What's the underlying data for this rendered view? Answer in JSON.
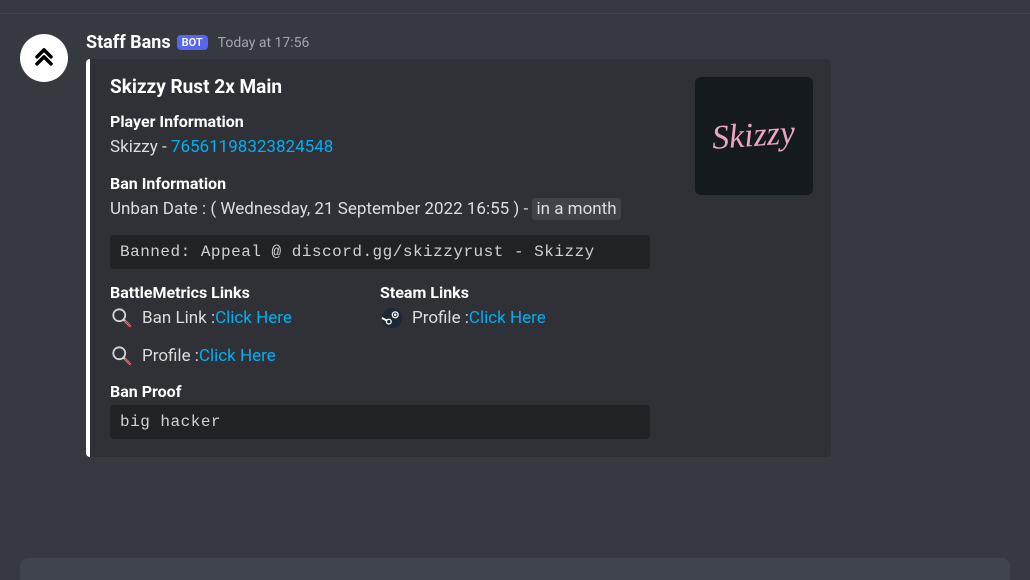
{
  "message": {
    "author": "Staff Bans",
    "bot_label": "BOT",
    "timestamp": "Today at 17:56"
  },
  "embed": {
    "title": "Skizzy Rust 2x Main",
    "player_info": {
      "heading": "Player Information",
      "prefix": "Skizzy - ",
      "id": "76561198323824548"
    },
    "ban_info": {
      "heading": "Ban Information",
      "prefix": "Unban Date : ( ",
      "date": "Wednesday, 21 September 2022 16:55",
      "middle": " ) -  ",
      "relative": "in a month"
    },
    "banned_code": "Banned: Appeal @ discord.gg/skizzyrust - Skizzy",
    "bm": {
      "heading": "BattleMetrics Links",
      "ban_label": "Ban Link : ",
      "ban_link": "Click Here",
      "profile_label": "Profile : ",
      "profile_link": "Click Here"
    },
    "steam": {
      "heading": "Steam Links",
      "profile_label": "Profile : ",
      "profile_link": "Click Here"
    },
    "proof": {
      "heading": "Ban Proof",
      "text": "big hacker"
    },
    "thumb_text": "Skizzy"
  }
}
